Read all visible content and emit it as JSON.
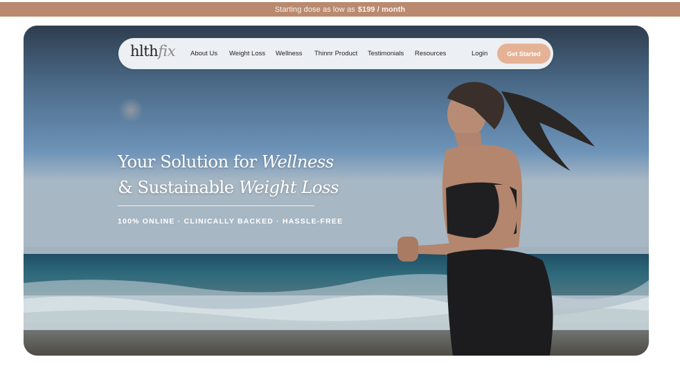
{
  "promo": {
    "text": "Starting dose as low as",
    "price": "$199 / month"
  },
  "nav": {
    "logo_main": "hlth",
    "logo_italic": "fix",
    "links": [
      "About Us",
      "Weight Loss",
      "Wellness",
      "Thinnr Product",
      "Testimonials",
      "Resources"
    ],
    "login": "Login",
    "cta": "Get Started"
  },
  "hero": {
    "headline_part1": "Your Solution for ",
    "headline_em1": "Wellness",
    "headline_part2": "& Sustainable ",
    "headline_em2": "Weight Loss",
    "tagline": "100% ONLINE · CLINICALLY BACKED · HASSLE-FREE",
    "image_subject": "woman running on beach"
  },
  "colors": {
    "promo_bar": "#b98a70",
    "cta": "#e5b296",
    "sky": "#5f86ac",
    "sea": "#1f5568"
  }
}
